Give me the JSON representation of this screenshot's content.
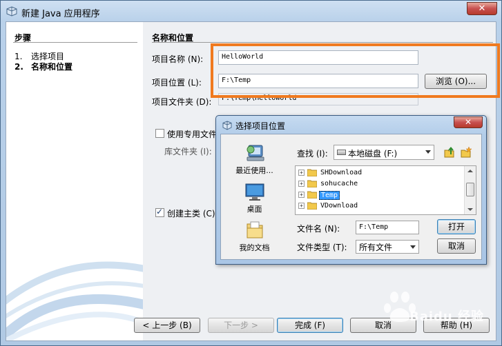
{
  "window": {
    "title": "新建 Java 应用程序",
    "close_label": "✕"
  },
  "steps": {
    "header": "步骤",
    "items": [
      {
        "num": "1.",
        "label": "选择项目"
      },
      {
        "num": "2.",
        "label": "名称和位置"
      }
    ]
  },
  "section": {
    "header": "名称和位置"
  },
  "form": {
    "project_name_label": "项目名称 (N):",
    "project_name_value": "HelloWorld",
    "project_location_label": "项目位置 (L):",
    "project_location_value": "F:\\Temp",
    "browse_label": "浏览 (O)...",
    "project_folder_label": "项目文件夹 (D):",
    "project_folder_value": "F:\\Temp\\HelloWorld",
    "dedicated_folder_label": "使用专用文件",
    "dedicated_folder_checked": false,
    "lib_folder_label": "库文件夹 (I):",
    "create_main_label": "创建主类 (C)",
    "create_main_checked": true
  },
  "footer": {
    "back_label": "< 上一步 (B)",
    "next_label": "下一步 >",
    "finish_label": "完成 (F)",
    "cancel_label": "取消",
    "help_label": "帮助 (H)"
  },
  "dialog": {
    "title": "选择项目位置",
    "close_label": "✕",
    "places": [
      {
        "label": "最近使用..."
      },
      {
        "label": "桌面"
      },
      {
        "label": "我的文档"
      }
    ],
    "look_in_label": "查找 (I):",
    "look_in_value": "本地磁盘 (F:)",
    "files": [
      {
        "name": "SHDownload",
        "selected": false
      },
      {
        "name": "sohucache",
        "selected": false
      },
      {
        "name": "Temp",
        "selected": true
      },
      {
        "name": "VDownload",
        "selected": false
      }
    ],
    "file_name_label": "文件名 (N):",
    "file_name_value": "F:\\Temp",
    "file_type_label": "文件类型 (T):",
    "file_type_value": "所有文件",
    "open_label": "打开",
    "cancel_label": "取消"
  },
  "watermark": {
    "text": "Baidu 经验"
  },
  "colors": {
    "highlight": "#f07a1f",
    "selection": "#3399ff",
    "title_gradient": "#b9d1ea"
  }
}
